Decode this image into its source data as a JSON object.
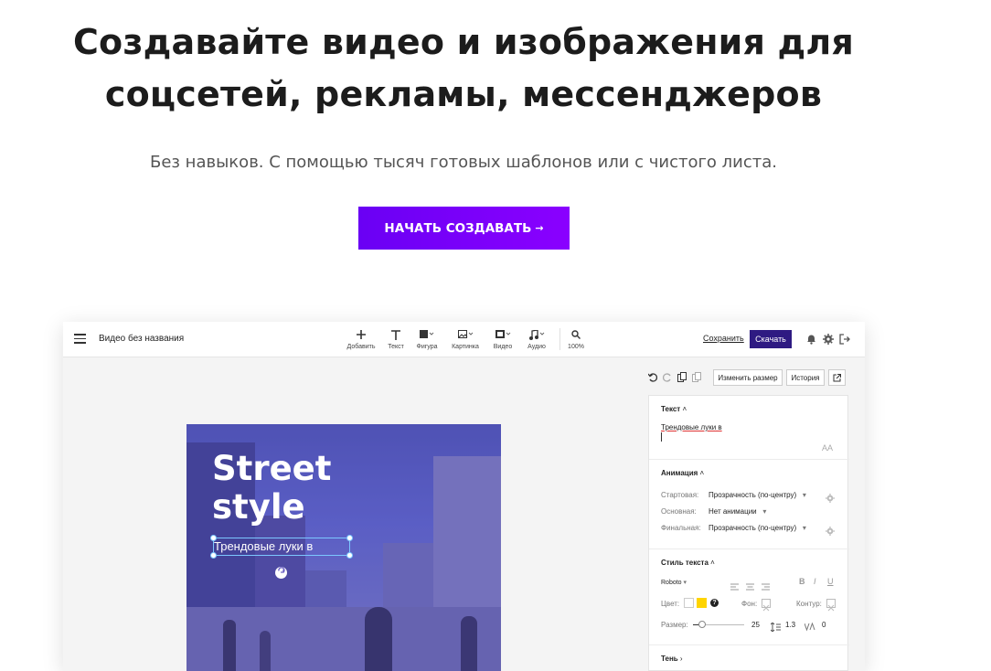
{
  "hero": {
    "title": "Создавайте видео и изображения для соцсетей, рекламы, мессенджеров",
    "subtitle": "Без навыков. С помощью тысяч готовых шаблонов или с чистого листа.",
    "cta_label": "НАЧАТЬ СОЗДАВАТЬ",
    "cta_arrow": "→",
    "accent_color": "#7300ff"
  },
  "editor": {
    "doc_name": "Видео без названия",
    "tools": [
      {
        "label": "Добавить",
        "icon": "plus-icon"
      },
      {
        "label": "Текст",
        "icon": "text-icon"
      },
      {
        "label": "Фигура",
        "icon": "shape-icon"
      },
      {
        "label": "Картинка",
        "icon": "image-icon"
      },
      {
        "label": "Видео",
        "icon": "video-icon"
      },
      {
        "label": "Аудио",
        "icon": "music-icon"
      },
      {
        "label": "100%",
        "icon": "zoom-icon"
      }
    ],
    "save_label": "Сохранить",
    "download_label": "Скачать",
    "resize_label": "Изменить размер",
    "history_label": "История",
    "canvas": {
      "title": "Street style",
      "selected_text": "Трендовые луки в"
    },
    "panel": {
      "text_section": "Текст",
      "text_value": "Трендовые луки в",
      "aa_label": "AA",
      "animation_section": "Анимация",
      "anim_start_label": "Стартовая:",
      "anim_start_value": "Прозрачность (по-центру)",
      "anim_main_label": "Основная:",
      "anim_main_value": "Нет анимации",
      "anim_final_label": "Финальная:",
      "anim_final_value": "Прозрачность (по-центру)",
      "style_section": "Стиль текста",
      "font": "Roboto",
      "color_label": "Цвет:",
      "bg_label": "Фон:",
      "outline_label": "Контур:",
      "size_label": "Размер:",
      "size_value": "25",
      "line_height_value": "1.3",
      "spacing_value": "0",
      "shadow_section": "Тень",
      "bold_glyph": "B",
      "italic_glyph": "I",
      "underline_glyph": "U",
      "help_glyph": "?",
      "color_swatch": "#ffffff",
      "color_swatch_2": "#ffd400"
    }
  }
}
